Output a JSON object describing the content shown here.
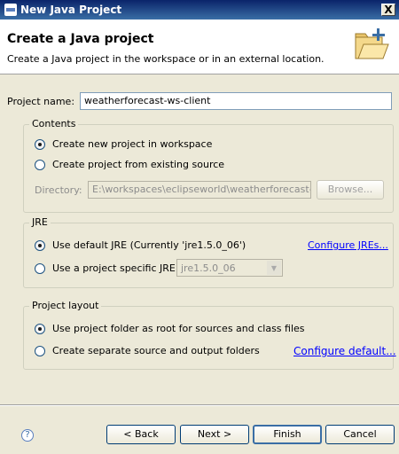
{
  "window": {
    "title": "New Java Project",
    "close_label": "X"
  },
  "banner": {
    "heading": "Create a Java project",
    "description": "Create a Java project in the workspace or in an external location."
  },
  "project_name": {
    "label": "Project name:",
    "value": "weatherforecast-ws-client"
  },
  "contents": {
    "legend": "Contents",
    "option_new": "Create new project in workspace",
    "option_existing": "Create project from existing source",
    "selected": "new",
    "directory_label": "Directory:",
    "directory_value": "E:\\workspaces\\eclipseworld\\weatherforecast-\\",
    "browse_label": "Browse..."
  },
  "jre": {
    "legend": "JRE",
    "option_default": "Use default JRE (Currently 'jre1.5.0_06')",
    "option_specific": "Use a project specific JRE:",
    "selected": "default",
    "specific_value": "jre1.5.0_06",
    "configure_link": "Configure JREs..."
  },
  "layout": {
    "legend": "Project layout",
    "option_root": "Use project folder as root for sources and class files",
    "option_separate": "Create separate source and output folders",
    "selected": "root",
    "configure_link": "Configure default..."
  },
  "footer": {
    "help_label": "?",
    "back_label": "< Back",
    "next_label": "Next >",
    "finish_label": "Finish",
    "cancel_label": "Cancel"
  }
}
